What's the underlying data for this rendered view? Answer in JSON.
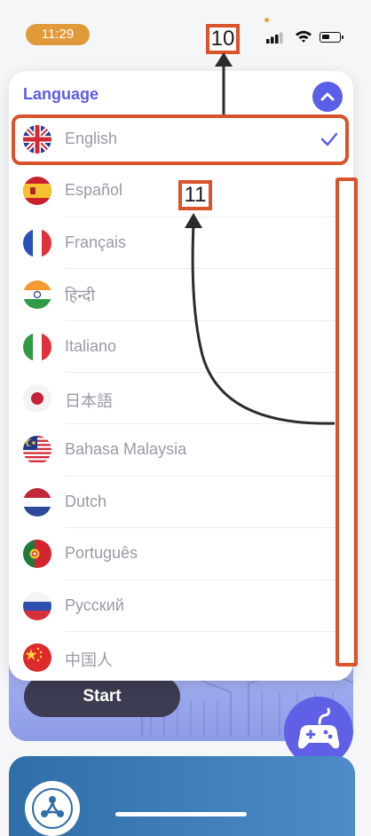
{
  "status_bar": {
    "time": "11:29"
  },
  "panel": {
    "title": "Language",
    "languages": [
      {
        "label": "English",
        "flag": "uk-flag-icon",
        "selected": true
      },
      {
        "label": "Español",
        "flag": "spain-flag-icon",
        "selected": false
      },
      {
        "label": "Français",
        "flag": "france-flag-icon",
        "selected": false
      },
      {
        "label": "हिन्दी",
        "flag": "india-flag-icon",
        "selected": false
      },
      {
        "label": "Italiano",
        "flag": "italy-flag-icon",
        "selected": false
      },
      {
        "label": "日本語",
        "flag": "japan-flag-icon",
        "selected": false
      },
      {
        "label": "Bahasa Malaysia",
        "flag": "malaysia-flag-icon",
        "selected": false
      },
      {
        "label": "Dutch",
        "flag": "netherlands-flag-icon",
        "selected": false
      },
      {
        "label": "Português",
        "flag": "portugal-flag-icon",
        "selected": false
      },
      {
        "label": "Русский",
        "flag": "russia-flag-icon",
        "selected": false
      },
      {
        "label": "中国人",
        "flag": "china-flag-icon",
        "selected": false
      }
    ]
  },
  "start_button": {
    "label": "Start"
  },
  "annotations": {
    "label_10": "10",
    "label_11": "11"
  },
  "colors": {
    "accent": "#5b5ee6",
    "annotation": "#d9532b",
    "time_pill": "#e09a3a"
  }
}
